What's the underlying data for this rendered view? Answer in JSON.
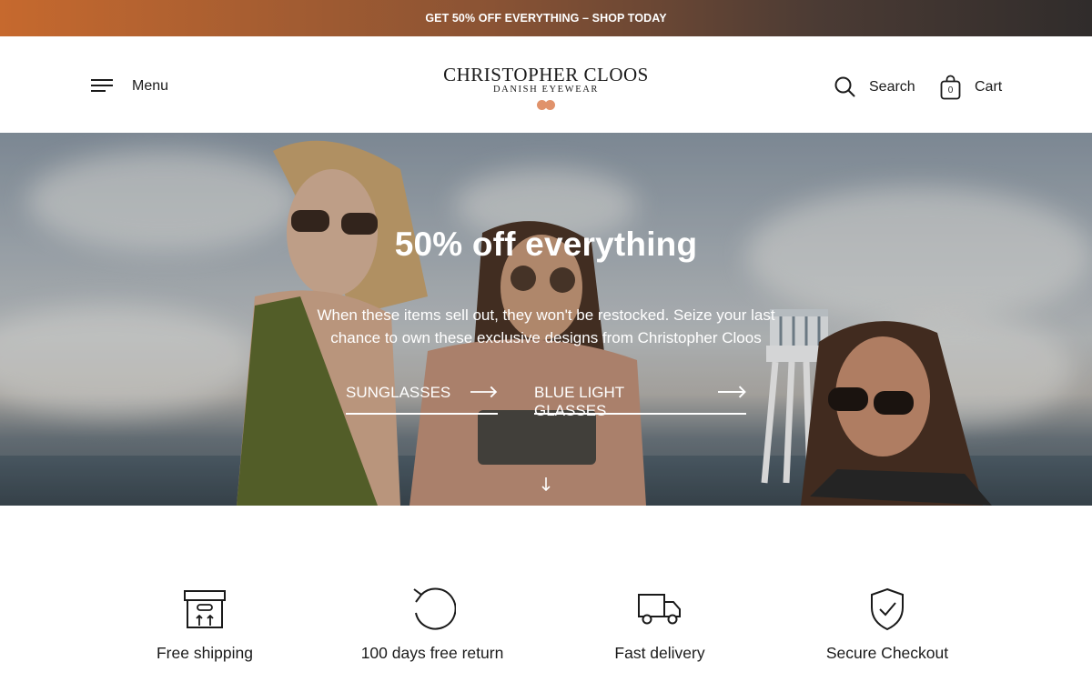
{
  "announcement": {
    "text": "GET 50% OFF EVERYTHING – SHOP TODAY"
  },
  "header": {
    "menu_label": "Menu",
    "logo": {
      "brand": "CHRISTOPHER CLOOS",
      "sub": "DANISH EYEWEAR"
    },
    "search_label": "Search",
    "cart_label": "Cart",
    "cart_count": "0"
  },
  "hero": {
    "title": "50% off everything",
    "text": "When these items sell out, they won't be restocked. Seize your last chance to own these exclusive designs from Christopher Cloos",
    "links": [
      {
        "label": "SUNGLASSES"
      },
      {
        "label": "BLUE LIGHT GLASSES"
      }
    ]
  },
  "features": [
    {
      "label": "Free shipping",
      "icon": "box-icon"
    },
    {
      "label": "100 days free return",
      "icon": "return-icon"
    },
    {
      "label": "Fast delivery",
      "icon": "truck-icon"
    },
    {
      "label": "Secure Checkout",
      "icon": "shield-check-icon"
    }
  ],
  "colors": {
    "announcement_start": "#c6692e",
    "announcement_end": "#302c2b",
    "logo_accent": "#e0926b",
    "text": "#1a1a1a"
  }
}
